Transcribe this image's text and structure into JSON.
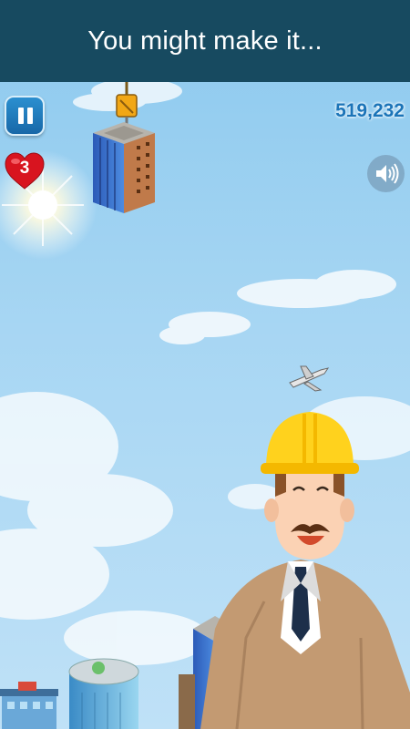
{
  "banner": {
    "message": "You might make it..."
  },
  "hud": {
    "pause_icon": "pause-icon",
    "lives": "3",
    "heart_icon": "heart-icon",
    "score": "519,232",
    "sound_icon": "speaker-volume-icon"
  },
  "colors": {
    "banner_bg": "#174a60",
    "sky_top": "#8cc9ee",
    "score_text": "#1b74b8",
    "heart": "#d8141f",
    "pause_button": "#2185c6",
    "helmet": "#ffd21d",
    "suit": "#c39a72"
  }
}
